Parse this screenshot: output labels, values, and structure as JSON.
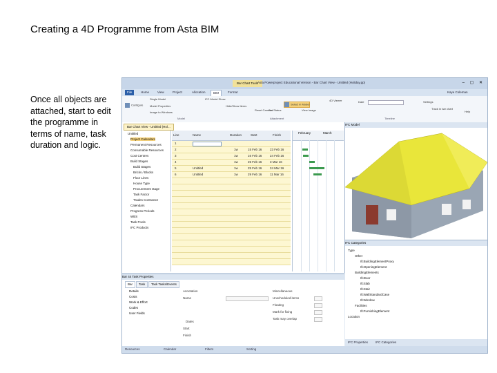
{
  "slide": {
    "title": "Creating a 4D Programme from Asta BIM",
    "caption": "Once all objects are attached, start to edit the programme in terms of name, task duration and logic."
  },
  "app": {
    "context_tab": "Bar Chart Tools",
    "window_title": "Asta Powerproject Educational Version - Bar Chart View - Untitled (Holiday.pp)",
    "window_controls": "– ▢ ✕",
    "tabs": [
      "File",
      "Home",
      "View",
      "Project",
      "Allocation",
      "BIM",
      "Format"
    ],
    "active_tab": "BIM",
    "ribbon": {
      "configure": "Configure",
      "model_properties": "Model Properties",
      "image_to_windows": "Image to Windows",
      "single_model": "Single Model",
      "ifc_model_show": "IFC Model Show",
      "model_label": "Model",
      "reset_camera": "Reset Camera",
      "hide_show_items": "Hide/Show Items",
      "set_status": "Set Status",
      "select_in_model": "Select in Model",
      "view_image": "View Image",
      "4d_viewer": "4D Viewer",
      "attachment_group": "Attachment",
      "date_label": "Date",
      "timeline_group": "Timeline",
      "settings": "Settings",
      "track_in_bar_chart": "Track in bar chart",
      "help": "Help",
      "user": "Kaye Coleman"
    },
    "doc_tab": "Bar Chart View - Untitled (Hol...",
    "tree": [
      "Untitled",
      "Project Calendars",
      "Permanent Resources",
      "Consumable Resources",
      "Cost Centres",
      "Build Stages",
      "Build Stages",
      "Bricks / Blocks",
      "Floor Lines",
      "House Type",
      "Procurement stage",
      "Task Factor",
      "Trades Contractor",
      "Calendars",
      "Progress Periods",
      "WBS",
      "Task Pools",
      "IFC Products"
    ],
    "grid_headers": [
      "Line",
      "Name",
      "Duration",
      "Start",
      "Finish"
    ],
    "chart_header_months": [
      "February",
      "March"
    ],
    "rows": [
      {
        "line": "1",
        "name": "",
        "duration": "",
        "start": "",
        "finish": ""
      },
      {
        "line": "2",
        "name": "",
        "duration": "1w",
        "start": "15 Feb 16",
        "finish": "23 Feb 16"
      },
      {
        "line": "3",
        "name": "",
        "duration": "1w",
        "start": "16 Feb 16",
        "finish": "24 Feb 16"
      },
      {
        "line": "4",
        "name": "",
        "duration": "1w",
        "start": "25 Feb 16",
        "finish": "3 Mar 16"
      },
      {
        "line": "5",
        "name": "Untitled",
        "duration": "1w",
        "start": "25 Feb 16",
        "finish": "24 Mar 16"
      },
      {
        "line": "6",
        "name": "Untitled",
        "duration": "1w",
        "start": "29 Feb 16",
        "finish": "11 Mar 16"
      }
    ],
    "ifc_model_title": "IFC Model",
    "ifc_categories_title": "IFC Categories",
    "categories": [
      "Type",
      "Other",
      "IfcBuildingElementProxy",
      "IfcOpeningElement",
      "BuildingElements",
      "IfcDoor",
      "IfcSlab",
      "IfcStair",
      "IfcWallStandardCase",
      "IfcWindow",
      "Facilities",
      "IfcFurnishingElement",
      "Location"
    ],
    "bottom_tabs": [
      "IFC Properties",
      "IFC Categories"
    ],
    "properties": {
      "title": "Bar 44 Task Properties",
      "tabs": [
        "Bar",
        "Task",
        "Task Tasks/Events"
      ],
      "sections": [
        "Details",
        "Costs",
        "Work & Effort",
        "Codes",
        "User Fields"
      ],
      "annotation_label": "Annotation",
      "name_label": "Name",
      "miscellaneous_label": "Miscellaneous",
      "unscheduled": "Unscheduled items",
      "floating": "Floating",
      "mark_for_fixing": "Mark for fixing",
      "task_may_overlap": "Task may overlap",
      "dates": "Dates",
      "start": "Start",
      "finish": "Finish"
    },
    "status_items": [
      "Resources",
      "Calendar",
      "Filters",
      "Sorting"
    ]
  }
}
